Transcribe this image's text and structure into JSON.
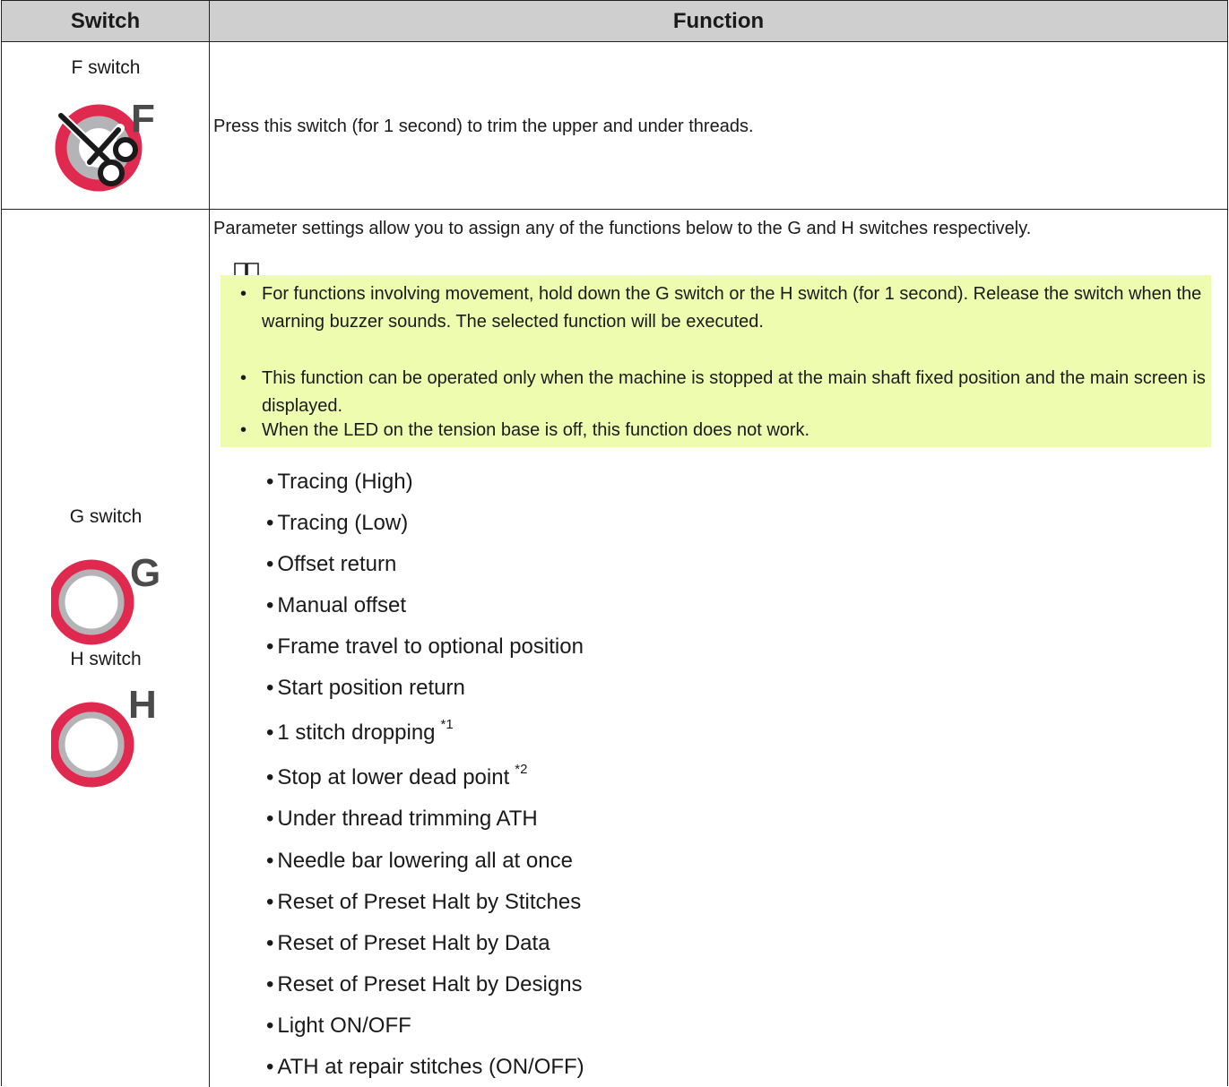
{
  "header": {
    "switch": "Switch",
    "function": "Function"
  },
  "f_switch": {
    "label": "F switch",
    "icon_letter": "F",
    "description": "Press this switch (for 1 second) to trim the upper and under threads."
  },
  "gh_switch": {
    "g_label": "G switch",
    "g_icon_letter": "G",
    "h_label": "H switch",
    "h_icon_letter": "H",
    "intro": "Parameter settings allow you to assign any of the functions below to the G and H switches respectively.",
    "note_icon": "book-icon",
    "notes": [
      "For functions involving movement, hold down the G switch or the H switch (for 1 second). Release the switch when the warning buzzer sounds. The selected function will be executed.",
      "This function can be operated only when the machine is stopped at the main shaft fixed position and the main screen is displayed.",
      "When the LED on the tension base is off, this function does not work."
    ],
    "functions": [
      {
        "text": "Tracing (High)",
        "sup": ""
      },
      {
        "text": "Tracing (Low)",
        "sup": ""
      },
      {
        "text": "Offset return",
        "sup": ""
      },
      {
        "text": "Manual offset",
        "sup": ""
      },
      {
        "text": "Frame travel to optional position",
        "sup": ""
      },
      {
        "text": "Start position return",
        "sup": ""
      },
      {
        "text": "1 stitch dropping",
        "sup": "*1"
      },
      {
        "text": "Stop at lower dead point",
        "sup": "*2"
      },
      {
        "text": "Under thread trimming ATH",
        "sup": ""
      },
      {
        "text": "Needle bar lowering all at once",
        "sup": ""
      },
      {
        "text": "Reset of Preset Halt by Stitches",
        "sup": ""
      },
      {
        "text": "Reset of Preset Halt by Data",
        "sup": ""
      },
      {
        "text": "Reset of Preset Halt by Designs",
        "sup": ""
      },
      {
        "text": "Light ON/OFF",
        "sup": ""
      },
      {
        "text": "ATH at repair stitches (ON/OFF)",
        "sup": ""
      }
    ]
  },
  "colors": {
    "header_bg": "#cfcfcf",
    "note_bg": "#eefcb0",
    "ring_red": "#e0294e",
    "ring_gray": "#b4b4b8",
    "letter_dark": "#4a4a4a"
  }
}
